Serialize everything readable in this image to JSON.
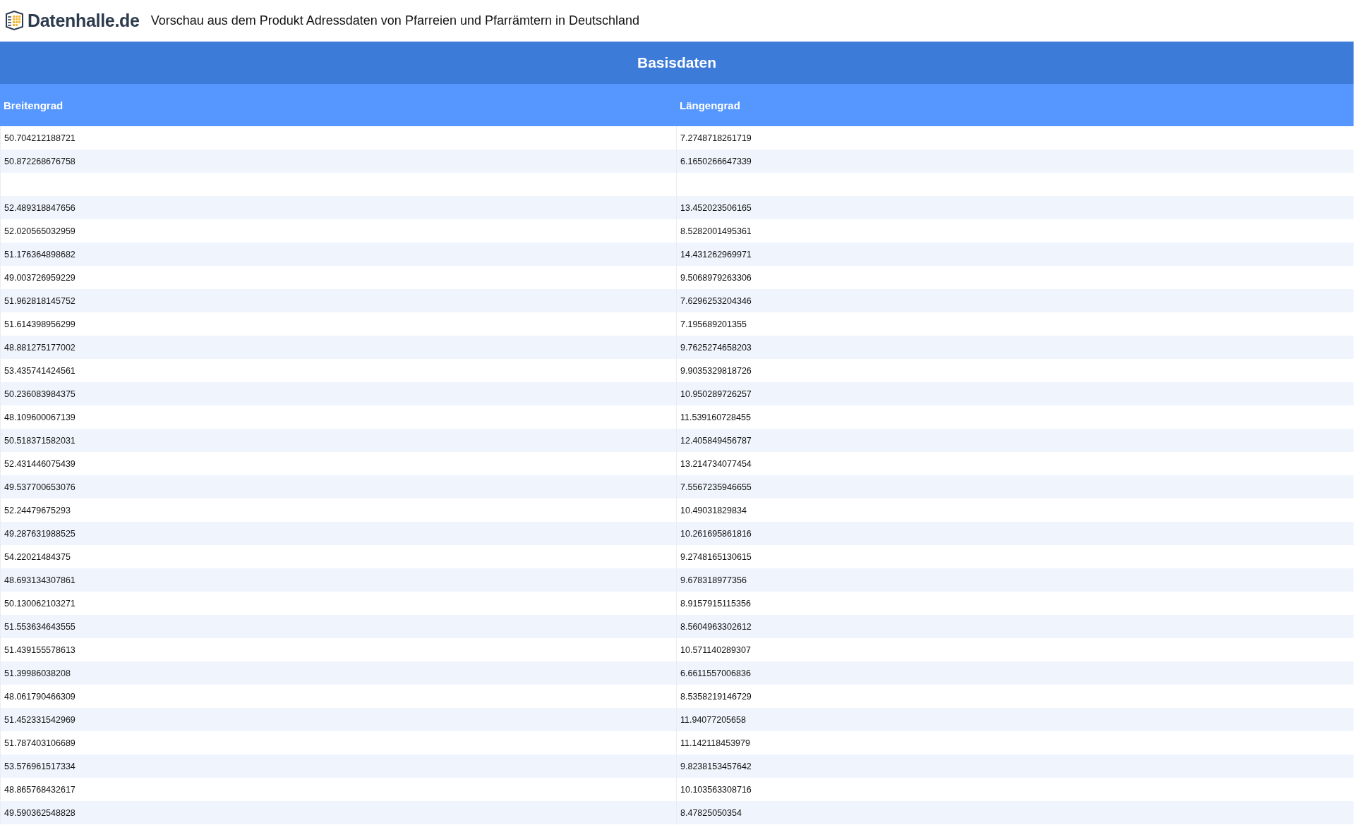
{
  "header": {
    "logo_text": "Datenhalle.de",
    "title": "Vorschau aus dem Produkt Adressdaten von Pfarreien und Pfarrämtern in Deutschland"
  },
  "table": {
    "caption": "Basisdaten",
    "columns": [
      "Breitengrad",
      "Längengrad"
    ],
    "rows": [
      [
        "50.704212188721",
        "7.2748718261719"
      ],
      [
        "50.872268676758",
        "6.1650266647339"
      ],
      [
        null,
        null
      ],
      [
        "52.489318847656",
        "13.452023506165"
      ],
      [
        "52.020565032959",
        "8.5282001495361"
      ],
      [
        "51.176364898682",
        "14.431262969971"
      ],
      [
        "49.003726959229",
        "9.5068979263306"
      ],
      [
        "51.962818145752",
        "7.6296253204346"
      ],
      [
        "51.614398956299",
        "7.195689201355"
      ],
      [
        "48.881275177002",
        "9.7625274658203"
      ],
      [
        "53.435741424561",
        "9.9035329818726"
      ],
      [
        "50.236083984375",
        "10.950289726257"
      ],
      [
        "48.109600067139",
        "11.539160728455"
      ],
      [
        "50.518371582031",
        "12.405849456787"
      ],
      [
        "52.431446075439",
        "13.214734077454"
      ],
      [
        "49.537700653076",
        "7.5567235946655"
      ],
      [
        "52.24479675293",
        "10.49031829834"
      ],
      [
        "49.287631988525",
        "10.261695861816"
      ],
      [
        "54.22021484375",
        "9.2748165130615"
      ],
      [
        "48.693134307861",
        "9.678318977356"
      ],
      [
        "50.130062103271",
        "8.9157915115356"
      ],
      [
        "51.553634643555",
        "8.5604963302612"
      ],
      [
        "51.439155578613",
        "10.571140289307"
      ],
      [
        "51.39986038208",
        "6.6611557006836"
      ],
      [
        "48.061790466309",
        "8.5358219146729"
      ],
      [
        "51.452331542969",
        "11.94077205658"
      ],
      [
        "51.787403106689",
        "11.142118453979"
      ],
      [
        "53.576961517334",
        "9.8238153457642"
      ],
      [
        "48.865768432617",
        "10.103563308716"
      ],
      [
        "49.590362548828",
        "8.47825050354"
      ]
    ]
  }
}
